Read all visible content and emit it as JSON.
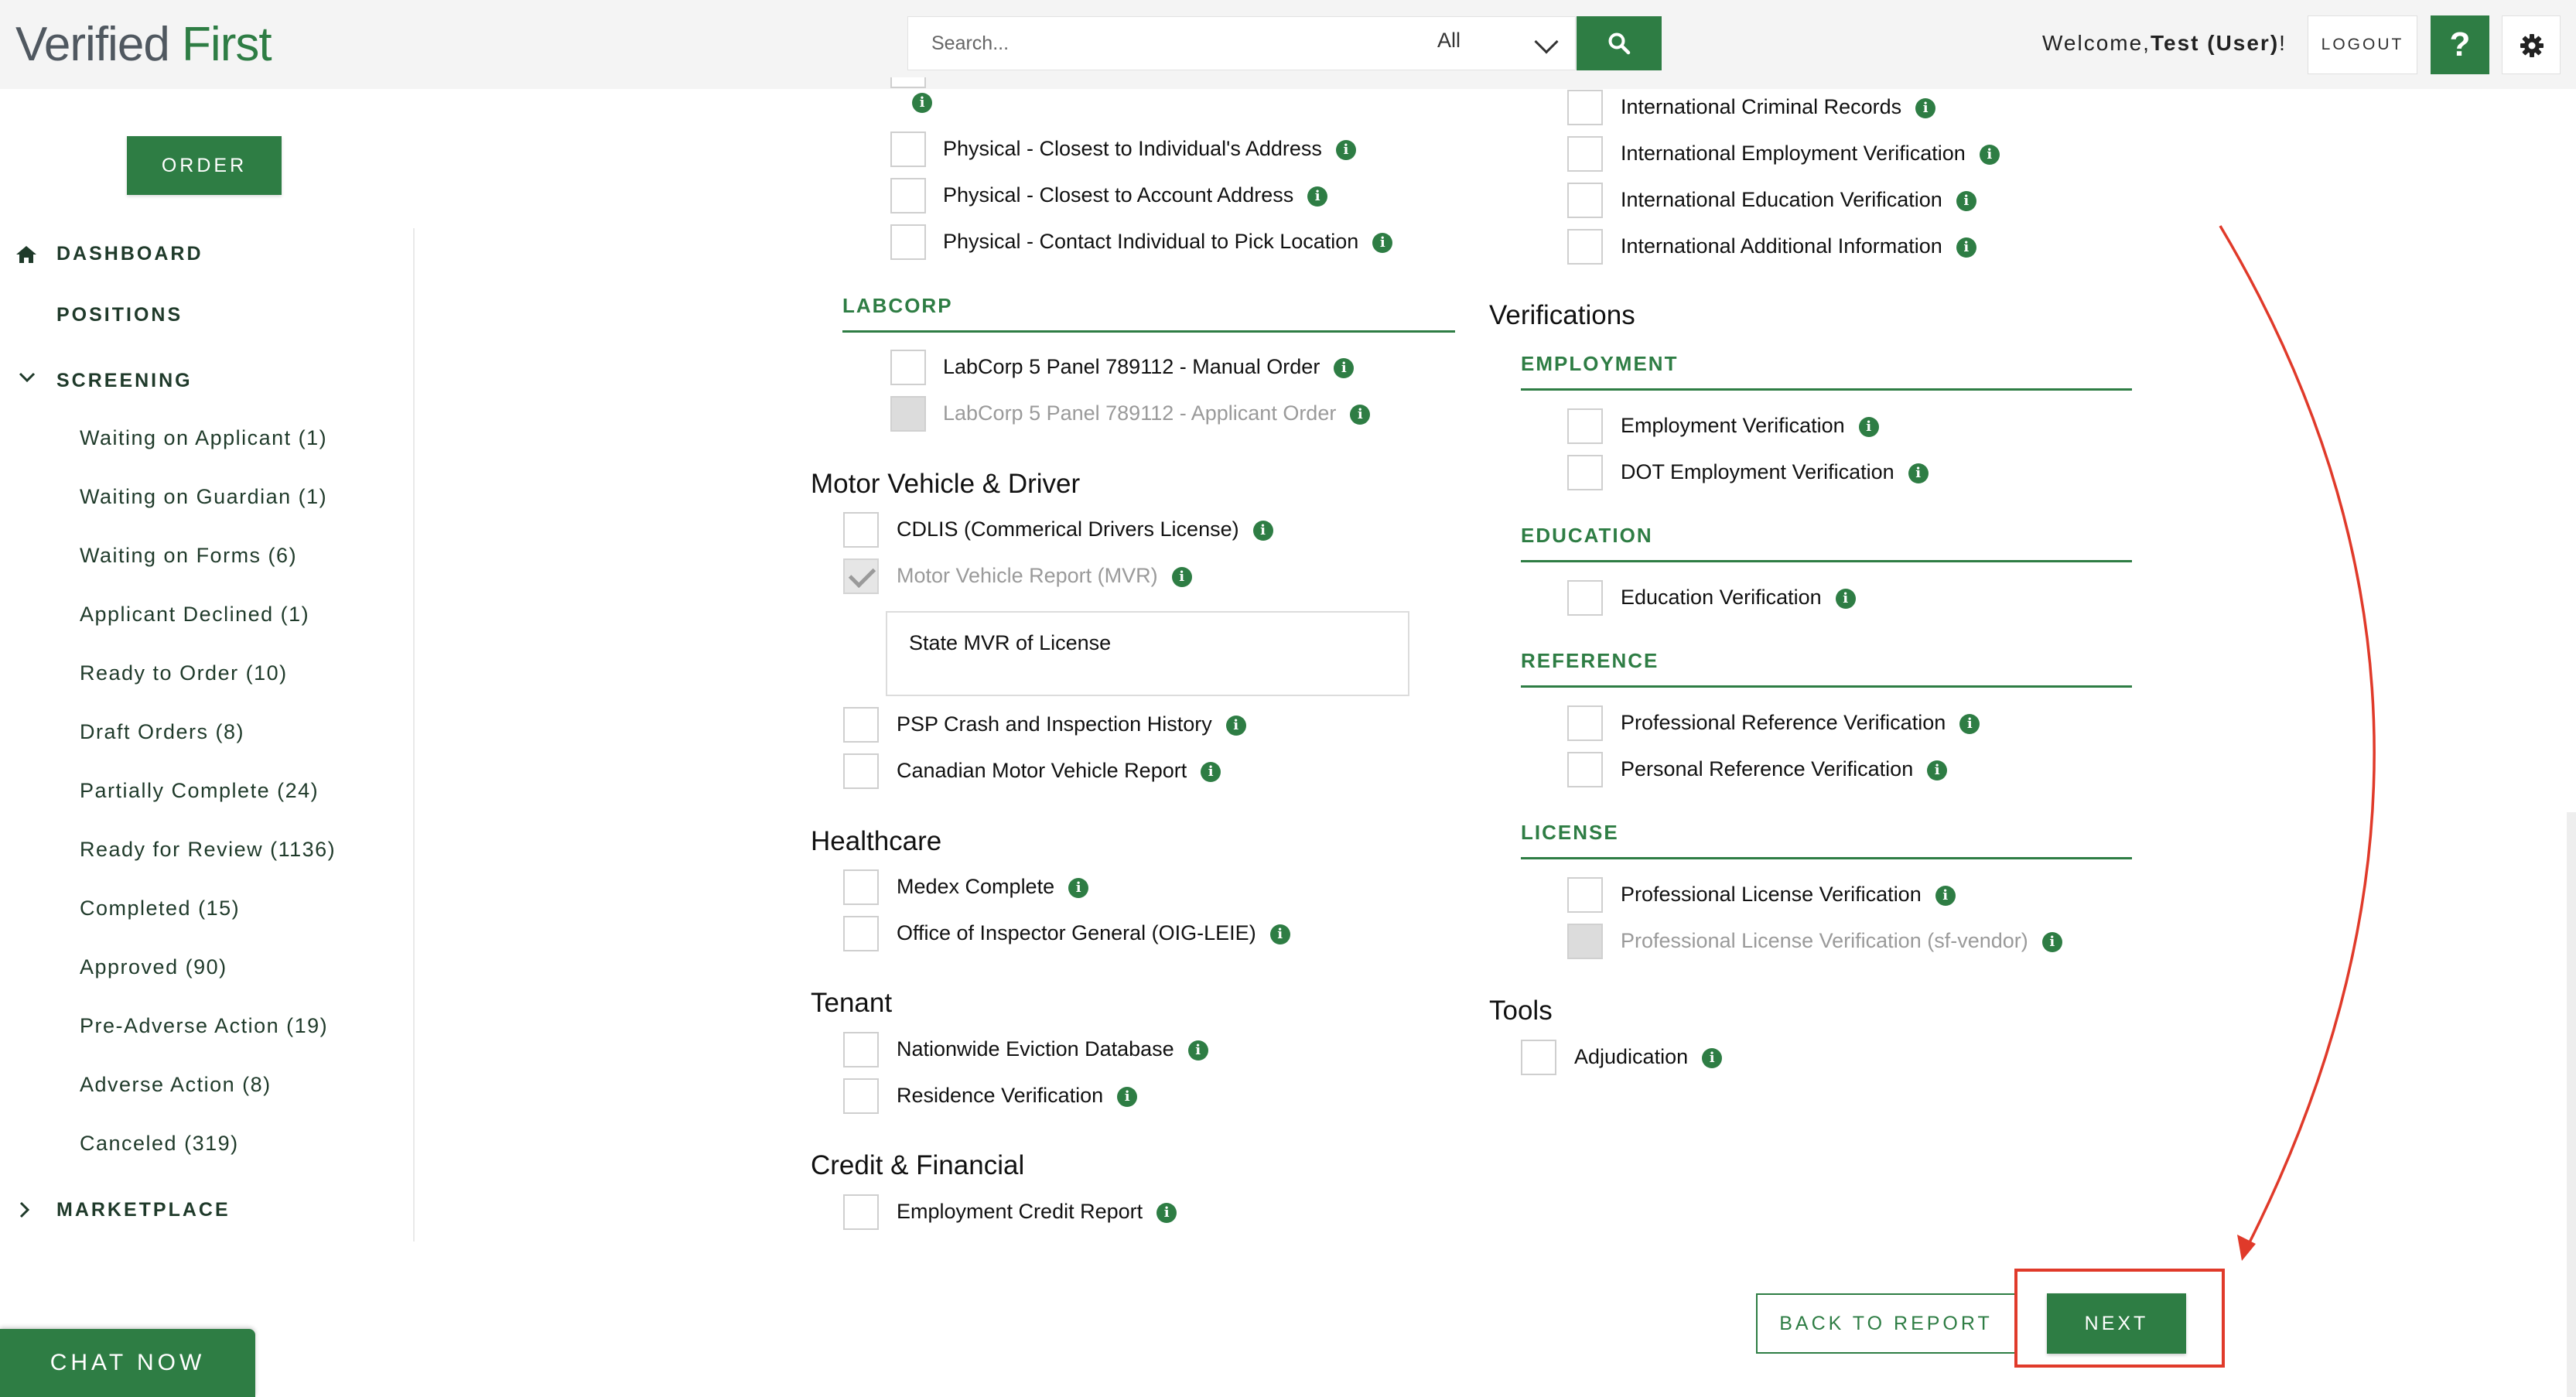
{
  "header": {
    "logo_part1": "Verified",
    "logo_part2": "First",
    "search_placeholder": "Search...",
    "search_scope": "All",
    "welcome_prefix": "Welcome,",
    "welcome_user": "Test (User)",
    "welcome_suffix": "!",
    "logout_label": "LOGOUT",
    "help_label": "?"
  },
  "sidebar": {
    "order_label": "ORDER",
    "dashboard": "DASHBOARD",
    "positions": "POSITIONS",
    "screening": "SCREENING",
    "screening_items": [
      "Waiting on Applicant (1)",
      "Waiting on Guardian (1)",
      "Waiting on Forms (6)",
      "Applicant Declined (1)",
      "Ready to Order (10)",
      "Draft Orders (8)",
      "Partially Complete (24)",
      "Ready for Review (1136)",
      "Completed (15)",
      "Approved (90)",
      "Pre-Adverse Action (19)",
      "Adverse Action (8)",
      "Canceled (319)"
    ],
    "marketplace": "MARKETPLACE"
  },
  "chat": {
    "label": "CHAT NOW"
  },
  "left_column": {
    "physical_items": [
      "Physical - Closest to Individual's Address",
      "Physical - Closest to Account Address",
      "Physical - Contact Individual to Pick Location"
    ],
    "labcorp_title": "LABCORP",
    "labcorp_items": [
      "LabCorp 5 Panel 789112 - Manual Order",
      "LabCorp 5 Panel 789112 - Applicant Order"
    ],
    "motor_title": "Motor Vehicle & Driver",
    "motor_items": [
      "CDLIS (Commerical Drivers License)",
      "Motor Vehicle Report (MVR)",
      "PSP Crash and Inspection History",
      "Canadian Motor Vehicle Report"
    ],
    "mvr_option": "State MVR of License",
    "healthcare_title": "Healthcare",
    "healthcare_items": [
      "Medex Complete",
      "Office of Inspector General (OIG-LEIE)"
    ],
    "tenant_title": "Tenant",
    "tenant_items": [
      "Nationwide Eviction Database",
      "Residence Verification"
    ],
    "credit_title": "Credit & Financial",
    "credit_items": [
      "Employment Credit Report"
    ]
  },
  "right_column": {
    "international_items": [
      "International Criminal Records",
      "International Employment Verification",
      "International Education Verification",
      "International Additional Information"
    ],
    "verifications_title": "Verifications",
    "employment_title": "EMPLOYMENT",
    "employment_items": [
      "Employment Verification",
      "DOT Employment Verification"
    ],
    "education_title": "EDUCATION",
    "education_items": [
      "Education Verification"
    ],
    "reference_title": "REFERENCE",
    "reference_items": [
      "Professional Reference Verification",
      "Personal Reference Verification"
    ],
    "license_title": "LICENSE",
    "license_items": [
      "Professional License Verification",
      "Professional License Verification (sf-vendor)"
    ],
    "tools_title": "Tools",
    "tools_items": [
      "Adjudication"
    ]
  },
  "footer": {
    "back_label": "BACK TO REPORT",
    "next_label": "NEXT"
  },
  "info_glyph": "i",
  "colors": {
    "brand_green": "#2e7d44",
    "annotation_red": "#e03a2a"
  }
}
